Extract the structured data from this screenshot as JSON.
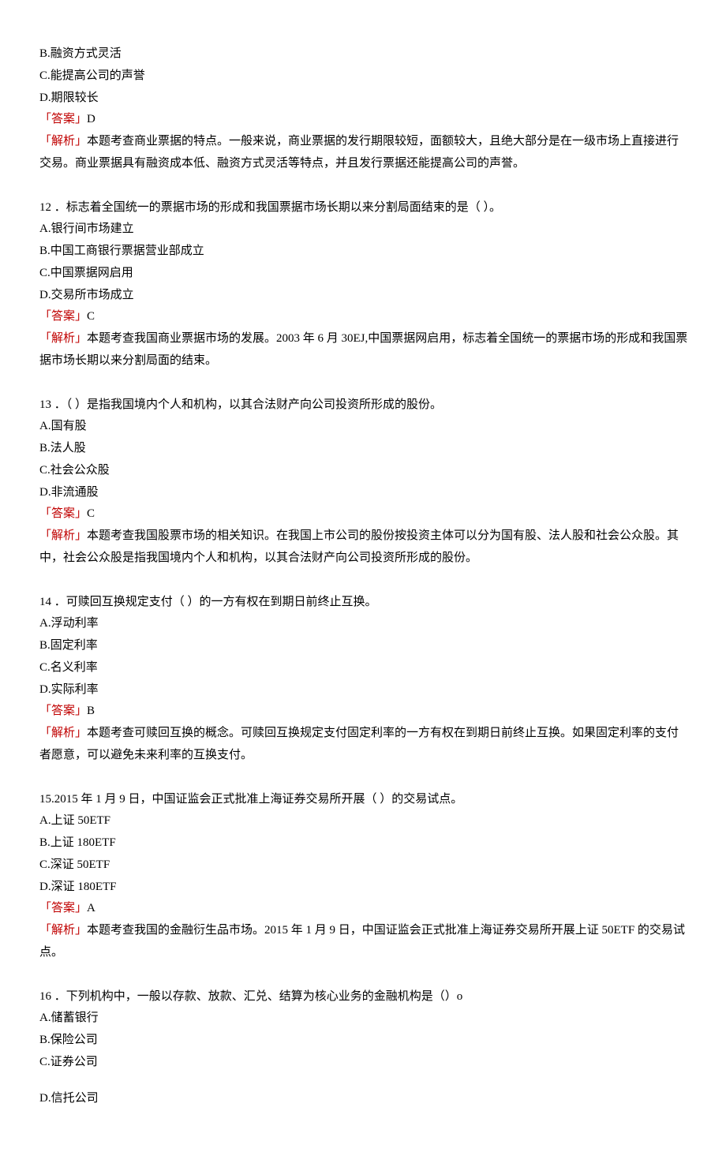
{
  "labels": {
    "answer": "「答案」",
    "explain": "「解析」"
  },
  "q11_frag": {
    "optB": "B.融资方式灵活",
    "optC": "C.能提高公司的声誉",
    "optD": "D.期限较长",
    "ans": "D",
    "exp": "本题考查商业票据的特点。一般来说，商业票据的发行期限较短，面额较大，且绝大部分是在一级市场上直接进行交易。商业票据具有融资成本低、融资方式灵活等特点，并且发行票据还能提高公司的声誉。"
  },
  "q12": {
    "stem": "12 ．标志着全国统一的票据市场的形成和我国票据市场长期以来分割局面结束的是（     ）。",
    "optA": "A.银行间市场建立",
    "optB": "B.中国工商银行票据营业部成立",
    "optC": "C.中国票据网启用",
    "optD": "D.交易所市场成立",
    "ans": "C",
    "exp": "本题考查我国商业票据市场的发展。2003 年 6 月 30EJ,中国票据网启用，标志着全国统一的票据市场的形成和我国票据市场长期以来分割局面的结束。"
  },
  "q13": {
    "stem": "13 ．（  ）是指我国境内个人和机构，以其合法财产向公司投资所形成的股份。",
    "optA": "A.国有股",
    "optB": "B.法人股",
    "optC": "C.社会公众股",
    "optD": "D.非流通股",
    "ans": "C",
    "exp": "本题考查我国股票市场的相关知识。在我国上市公司的股份按投资主体可以分为国有股、法人股和社会公众股。其中，社会公众股是指我国境内个人和机构，以其合法财产向公司投资所形成的股份。"
  },
  "q14": {
    "stem": "14 ．可赎回互换规定支付（  ）的一方有权在到期日前终止互换。",
    "optA": "A.浮动利率",
    "optB": "B.固定利率",
    "optC": "C.名义利率",
    "optD": "D.实际利率",
    "ans": "B",
    "exp": "本题考查可赎回互换的概念。可赎回互换规定支付固定利率的一方有权在到期日前终止互换。如果固定利率的支付者愿意，可以避免未来利率的互换支付。"
  },
  "q15": {
    "stem": "15.2015 年 1 月 9 日，中国证监会正式批准上海证券交易所开展（     ）的交易试点。",
    "optA": "A.上证 50ETF",
    "optB": "B.上证 180ETF",
    "optC": "C.深证 50ETF",
    "optD": "D.深证 180ETF",
    "ans": "A",
    "exp": "本题考查我国的金融衍生品市场。2015 年 1 月 9 日，中国证监会正式批准上海证券交易所开展上证 50ETF 的交易试点。"
  },
  "q16": {
    "stem": "16 ．下列机构中，一般以存款、放款、汇兑、结算为核心业务的金融机构是（）o",
    "optA": "A.储蓄银行",
    "optB": "B.保险公司",
    "optC": "C.证券公司",
    "optD": "D.信托公司"
  }
}
